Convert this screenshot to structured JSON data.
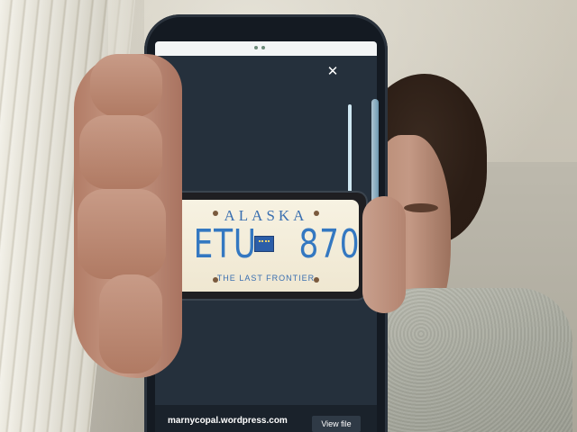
{
  "plate": {
    "state": "ALASKA",
    "number_left": "ETU",
    "number_right": "870",
    "slogan": "THE LAST FRONTIER"
  },
  "viewer": {
    "close_glyph": "✕",
    "source_link": "marnycopal.wordpress.com",
    "view_file_label": "View file"
  },
  "icons": {
    "close": "close-icon",
    "plate_emblem": "flag-icon"
  },
  "colors": {
    "plate_text": "#3478c1",
    "plate_background": "#f3eedc",
    "phone_body": "#141a22"
  }
}
